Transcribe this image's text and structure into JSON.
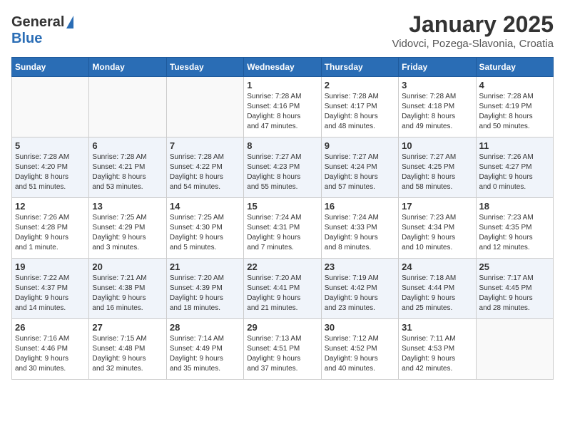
{
  "header": {
    "logo_general": "General",
    "logo_blue": "Blue",
    "month_title": "January 2025",
    "subtitle": "Vidovci, Pozega-Slavonia, Croatia"
  },
  "days_of_week": [
    "Sunday",
    "Monday",
    "Tuesday",
    "Wednesday",
    "Thursday",
    "Friday",
    "Saturday"
  ],
  "weeks": [
    {
      "alt": false,
      "days": [
        {
          "num": "",
          "info": ""
        },
        {
          "num": "",
          "info": ""
        },
        {
          "num": "",
          "info": ""
        },
        {
          "num": "1",
          "info": "Sunrise: 7:28 AM\nSunset: 4:16 PM\nDaylight: 8 hours\nand 47 minutes."
        },
        {
          "num": "2",
          "info": "Sunrise: 7:28 AM\nSunset: 4:17 PM\nDaylight: 8 hours\nand 48 minutes."
        },
        {
          "num": "3",
          "info": "Sunrise: 7:28 AM\nSunset: 4:18 PM\nDaylight: 8 hours\nand 49 minutes."
        },
        {
          "num": "4",
          "info": "Sunrise: 7:28 AM\nSunset: 4:19 PM\nDaylight: 8 hours\nand 50 minutes."
        }
      ]
    },
    {
      "alt": true,
      "days": [
        {
          "num": "5",
          "info": "Sunrise: 7:28 AM\nSunset: 4:20 PM\nDaylight: 8 hours\nand 51 minutes."
        },
        {
          "num": "6",
          "info": "Sunrise: 7:28 AM\nSunset: 4:21 PM\nDaylight: 8 hours\nand 53 minutes."
        },
        {
          "num": "7",
          "info": "Sunrise: 7:28 AM\nSunset: 4:22 PM\nDaylight: 8 hours\nand 54 minutes."
        },
        {
          "num": "8",
          "info": "Sunrise: 7:27 AM\nSunset: 4:23 PM\nDaylight: 8 hours\nand 55 minutes."
        },
        {
          "num": "9",
          "info": "Sunrise: 7:27 AM\nSunset: 4:24 PM\nDaylight: 8 hours\nand 57 minutes."
        },
        {
          "num": "10",
          "info": "Sunrise: 7:27 AM\nSunset: 4:25 PM\nDaylight: 8 hours\nand 58 minutes."
        },
        {
          "num": "11",
          "info": "Sunrise: 7:26 AM\nSunset: 4:27 PM\nDaylight: 9 hours\nand 0 minutes."
        }
      ]
    },
    {
      "alt": false,
      "days": [
        {
          "num": "12",
          "info": "Sunrise: 7:26 AM\nSunset: 4:28 PM\nDaylight: 9 hours\nand 1 minute."
        },
        {
          "num": "13",
          "info": "Sunrise: 7:25 AM\nSunset: 4:29 PM\nDaylight: 9 hours\nand 3 minutes."
        },
        {
          "num": "14",
          "info": "Sunrise: 7:25 AM\nSunset: 4:30 PM\nDaylight: 9 hours\nand 5 minutes."
        },
        {
          "num": "15",
          "info": "Sunrise: 7:24 AM\nSunset: 4:31 PM\nDaylight: 9 hours\nand 7 minutes."
        },
        {
          "num": "16",
          "info": "Sunrise: 7:24 AM\nSunset: 4:33 PM\nDaylight: 9 hours\nand 8 minutes."
        },
        {
          "num": "17",
          "info": "Sunrise: 7:23 AM\nSunset: 4:34 PM\nDaylight: 9 hours\nand 10 minutes."
        },
        {
          "num": "18",
          "info": "Sunrise: 7:23 AM\nSunset: 4:35 PM\nDaylight: 9 hours\nand 12 minutes."
        }
      ]
    },
    {
      "alt": true,
      "days": [
        {
          "num": "19",
          "info": "Sunrise: 7:22 AM\nSunset: 4:37 PM\nDaylight: 9 hours\nand 14 minutes."
        },
        {
          "num": "20",
          "info": "Sunrise: 7:21 AM\nSunset: 4:38 PM\nDaylight: 9 hours\nand 16 minutes."
        },
        {
          "num": "21",
          "info": "Sunrise: 7:20 AM\nSunset: 4:39 PM\nDaylight: 9 hours\nand 18 minutes."
        },
        {
          "num": "22",
          "info": "Sunrise: 7:20 AM\nSunset: 4:41 PM\nDaylight: 9 hours\nand 21 minutes."
        },
        {
          "num": "23",
          "info": "Sunrise: 7:19 AM\nSunset: 4:42 PM\nDaylight: 9 hours\nand 23 minutes."
        },
        {
          "num": "24",
          "info": "Sunrise: 7:18 AM\nSunset: 4:44 PM\nDaylight: 9 hours\nand 25 minutes."
        },
        {
          "num": "25",
          "info": "Sunrise: 7:17 AM\nSunset: 4:45 PM\nDaylight: 9 hours\nand 28 minutes."
        }
      ]
    },
    {
      "alt": false,
      "days": [
        {
          "num": "26",
          "info": "Sunrise: 7:16 AM\nSunset: 4:46 PM\nDaylight: 9 hours\nand 30 minutes."
        },
        {
          "num": "27",
          "info": "Sunrise: 7:15 AM\nSunset: 4:48 PM\nDaylight: 9 hours\nand 32 minutes."
        },
        {
          "num": "28",
          "info": "Sunrise: 7:14 AM\nSunset: 4:49 PM\nDaylight: 9 hours\nand 35 minutes."
        },
        {
          "num": "29",
          "info": "Sunrise: 7:13 AM\nSunset: 4:51 PM\nDaylight: 9 hours\nand 37 minutes."
        },
        {
          "num": "30",
          "info": "Sunrise: 7:12 AM\nSunset: 4:52 PM\nDaylight: 9 hours\nand 40 minutes."
        },
        {
          "num": "31",
          "info": "Sunrise: 7:11 AM\nSunset: 4:53 PM\nDaylight: 9 hours\nand 42 minutes."
        },
        {
          "num": "",
          "info": ""
        }
      ]
    }
  ]
}
